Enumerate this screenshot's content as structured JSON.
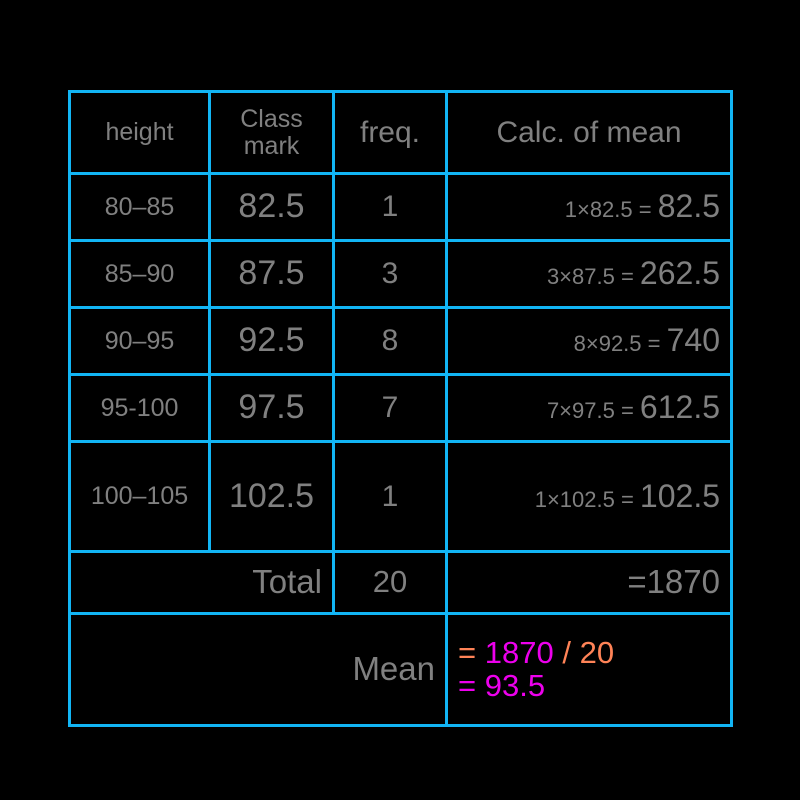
{
  "table": {
    "headers": {
      "height": "height",
      "class_mark_line1": "Class",
      "class_mark_line2": "mark",
      "freq": "freq.",
      "calc": "Calc. of mean"
    },
    "rows": [
      {
        "height": "80–85",
        "class_mark": "82.5",
        "freq": "1",
        "calc_expr": "1×82.5 = ",
        "calc_product": "82.5"
      },
      {
        "height": "85–90",
        "class_mark": "87.5",
        "freq": "3",
        "calc_expr": "3×87.5 = ",
        "calc_product": "262.5"
      },
      {
        "height": "90–95",
        "class_mark": "92.5",
        "freq": "8",
        "calc_expr": "8×92.5 = ",
        "calc_product": "740"
      },
      {
        "height": "95-100",
        "class_mark": "97.5",
        "freq": "7",
        "calc_expr": "7×97.5 = ",
        "calc_product": "612.5"
      },
      {
        "height": "100–105",
        "class_mark": "102.5",
        "freq": "1",
        "calc_expr": "1×102.5 = ",
        "calc_product": "102.5"
      }
    ],
    "total_row": {
      "label": "Total",
      "freq": "20",
      "sum": "=1870"
    },
    "mean_row": {
      "label": "Mean",
      "eq1": "=",
      "numerator": "1870",
      "divider": "/",
      "denominator": "20",
      "eq2": "=",
      "result": "93.5"
    }
  },
  "colors": {
    "border": "#12b5f5",
    "text": "#808080",
    "orange": "#ff8357",
    "magenta": "#ed00ed",
    "background": "#000000"
  },
  "chart_data": {
    "type": "table",
    "title": "Calc. of mean",
    "columns": [
      "height",
      "Class mark",
      "freq.",
      "Calc. of mean"
    ],
    "categories": [
      "80–85",
      "85–90",
      "90–95",
      "95-100",
      "100–105"
    ],
    "class_marks": [
      82.5,
      87.5,
      92.5,
      97.5,
      102.5
    ],
    "frequencies": [
      1,
      3,
      8,
      7,
      1
    ],
    "products": [
      82.5,
      262.5,
      740,
      612.5,
      102.5
    ],
    "total_frequency": 20,
    "total_product_sum": 1870,
    "mean": 93.5
  }
}
